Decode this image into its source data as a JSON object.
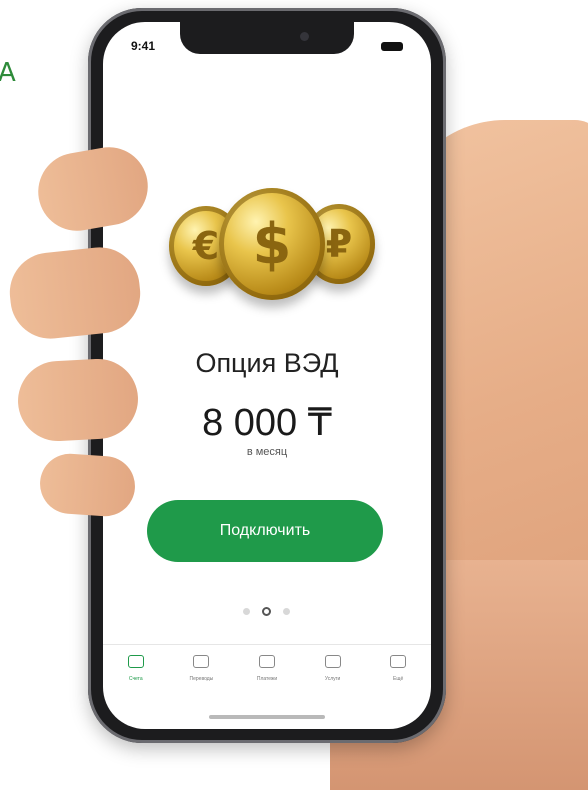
{
  "edge_letter": "A",
  "status_bar": {
    "time": "9:41"
  },
  "offer": {
    "title": "Опция ВЭД",
    "price": "8 000 ₸",
    "period": "в месяц",
    "button_label": "Подключить"
  },
  "carousel": {
    "total": 3,
    "active_index": 2
  },
  "tab_bar": {
    "items": [
      {
        "label": "Счета",
        "icon": "home-icon",
        "active": true
      },
      {
        "label": "Переводы",
        "icon": "transfer-icon",
        "active": false
      },
      {
        "label": "Платежи",
        "icon": "payments-icon",
        "active": false
      },
      {
        "label": "Услуги",
        "icon": "services-icon",
        "active": false
      },
      {
        "label": "Ещё",
        "icon": "more-icon",
        "active": false
      }
    ]
  },
  "colors": {
    "accent": "#1f9a4a",
    "coin_gold": "#d4a82c"
  },
  "coin_symbols": [
    "€",
    "$",
    "₽"
  ]
}
